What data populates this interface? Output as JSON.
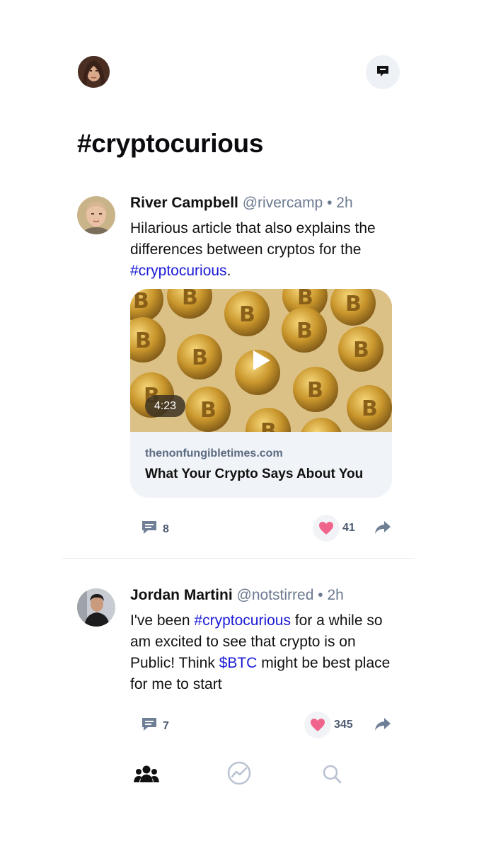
{
  "header": {
    "title": "#cryptocurious"
  },
  "posts": [
    {
      "name": "River Campbell",
      "handle": "@rivercamp",
      "sep": "•",
      "time": "2h",
      "body_parts": [
        "Hilarious article that also explains the differences between cryptos for the ",
        "#cryptocurious",
        "."
      ],
      "link_card": {
        "domain": "thenonfungibletimes.com",
        "title": "What Your Crypto Says About You",
        "duration": "4:23"
      },
      "comments": "8",
      "likes": "41"
    },
    {
      "name": "Jordan Martini",
      "handle": "@notstirred",
      "sep": "•",
      "time": "2h",
      "body_parts": [
        "I've been ",
        "#cryptocurious",
        " for a while so am excited to see that crypto is on Public! Think ",
        "$BTC",
        " might be best place for me to start"
      ],
      "comments": "7",
      "likes": "345"
    }
  ],
  "nav": {
    "items": [
      "community-icon",
      "activity-icon",
      "search-icon"
    ]
  },
  "colors": {
    "accent_link": "#1a1ad6",
    "heart": "#f0648c",
    "muted": "#6b7a90"
  }
}
